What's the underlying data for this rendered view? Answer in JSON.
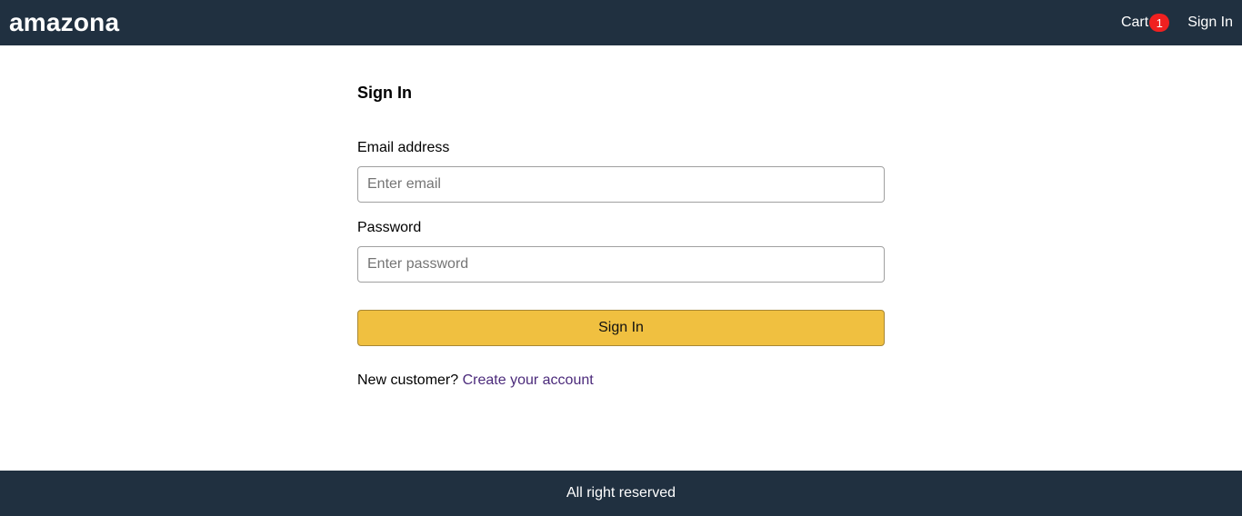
{
  "header": {
    "brand": "amazona",
    "cart_label": "Cart",
    "cart_count": "1",
    "signin_label": "Sign In"
  },
  "form": {
    "title": "Sign In",
    "email_label": "Email address",
    "email_placeholder": "Enter email",
    "email_value": "",
    "password_label": "Password",
    "password_placeholder": "Enter password",
    "password_value": "",
    "submit_label": "Sign In",
    "new_customer_text": "New customer?",
    "create_account_label": "Create your account"
  },
  "footer": {
    "text": "All right reserved"
  },
  "colors": {
    "header_bg": "#203040",
    "button_bg": "#f0c040",
    "badge_bg": "#f02020",
    "link": "#4b2a7b"
  }
}
